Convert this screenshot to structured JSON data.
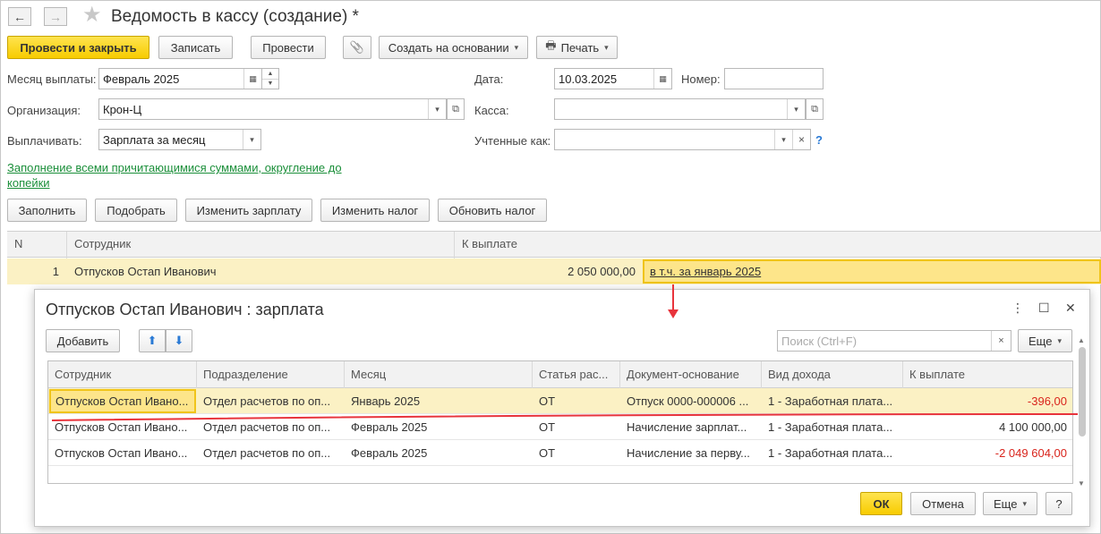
{
  "header": {
    "back_icon": "←",
    "forward_icon": "→",
    "star_icon": "★",
    "title": "Ведомость в кассу (создание) *"
  },
  "toolbar": {
    "post_and_close": "Провести и закрыть",
    "save": "Записать",
    "post": "Провести",
    "attach_icon": "📎",
    "create_based_on": "Создать на основании",
    "print": "Печать",
    "print_icon": "🖶",
    "dropdown_icon": "▾"
  },
  "form": {
    "month_label": "Месяц выплаты:",
    "month_value": "Февраль 2025",
    "date_label": "Дата:",
    "date_value": "10.03.2025",
    "number_label": "Номер:",
    "number_value": "",
    "org_label": "Организация:",
    "org_value": "Крон-Ц",
    "cash_label": "Касса:",
    "cash_value": "",
    "pay_label": "Выплачивать:",
    "pay_value": "Зарплата за месяц",
    "recorded_label": "Учтенные как:",
    "recorded_value": "",
    "help": "?",
    "calendar_icon": "▦",
    "open_icon": "⧉",
    "clear_icon": "×",
    "spin_up": "▲",
    "spin_down": "▼"
  },
  "fill_link": "Заполнение всеми причитающимися суммами, округление до копейки",
  "actions": {
    "fill": "Заполнить",
    "pick": "Подобрать",
    "change_salary": "Изменить зарплату",
    "change_tax": "Изменить налог",
    "refresh_tax": "Обновить налог"
  },
  "table": {
    "columns": [
      "N",
      "Сотрудник",
      "К выплате"
    ],
    "rows": [
      {
        "n": "1",
        "employee": "Отпусков Остап Иванович",
        "amount": "2 050 000,00",
        "detail": "в т.ч. за январь 2025"
      }
    ]
  },
  "dialog": {
    "title": "Отпусков Остап Иванович : зарплата",
    "more_icon": "⋮",
    "maximize_icon": "☐",
    "close_icon": "✕",
    "add": "Добавить",
    "up_icon": "⬆",
    "down_icon": "⬇",
    "search_placeholder": "Поиск (Ctrl+F)",
    "more": "Еще",
    "columns": [
      "Сотрудник",
      "Подразделение",
      "Месяц",
      "Статья рас...",
      "Документ-основание",
      "Вид дохода",
      "К выплате"
    ],
    "rows": [
      {
        "employee": "Отпусков Остап Ивано...",
        "department": "Отдел расчетов по оп...",
        "month": "Январь 2025",
        "article": "ОТ",
        "document": "Отпуск 0000-000006 ...",
        "income": "1 - Заработная плата...",
        "amount": "-396,00",
        "negative": true
      },
      {
        "employee": "Отпусков Остап Ивано...",
        "department": "Отдел расчетов по оп...",
        "month": "Февраль 2025",
        "article": "ОТ",
        "document": "Начисление зарплат...",
        "income": "1 - Заработная плата...",
        "amount": "4 100 000,00",
        "negative": false
      },
      {
        "employee": "Отпусков Остап Ивано...",
        "department": "Отдел расчетов по оп...",
        "month": "Февраль 2025",
        "article": "ОТ",
        "document": "Начисление за перву...",
        "income": "1 - Заработная плата...",
        "amount": "-2 049 604,00",
        "negative": true
      }
    ],
    "ok": "ОК",
    "cancel": "Отмена",
    "more2": "Еще",
    "help": "?"
  },
  "colors": {
    "accent_yellow": "#f7cc00",
    "selection": "#fbf1c4",
    "negative": "#d9251d",
    "link_green": "#1b8f3a",
    "annotation_red": "#e8343c"
  }
}
